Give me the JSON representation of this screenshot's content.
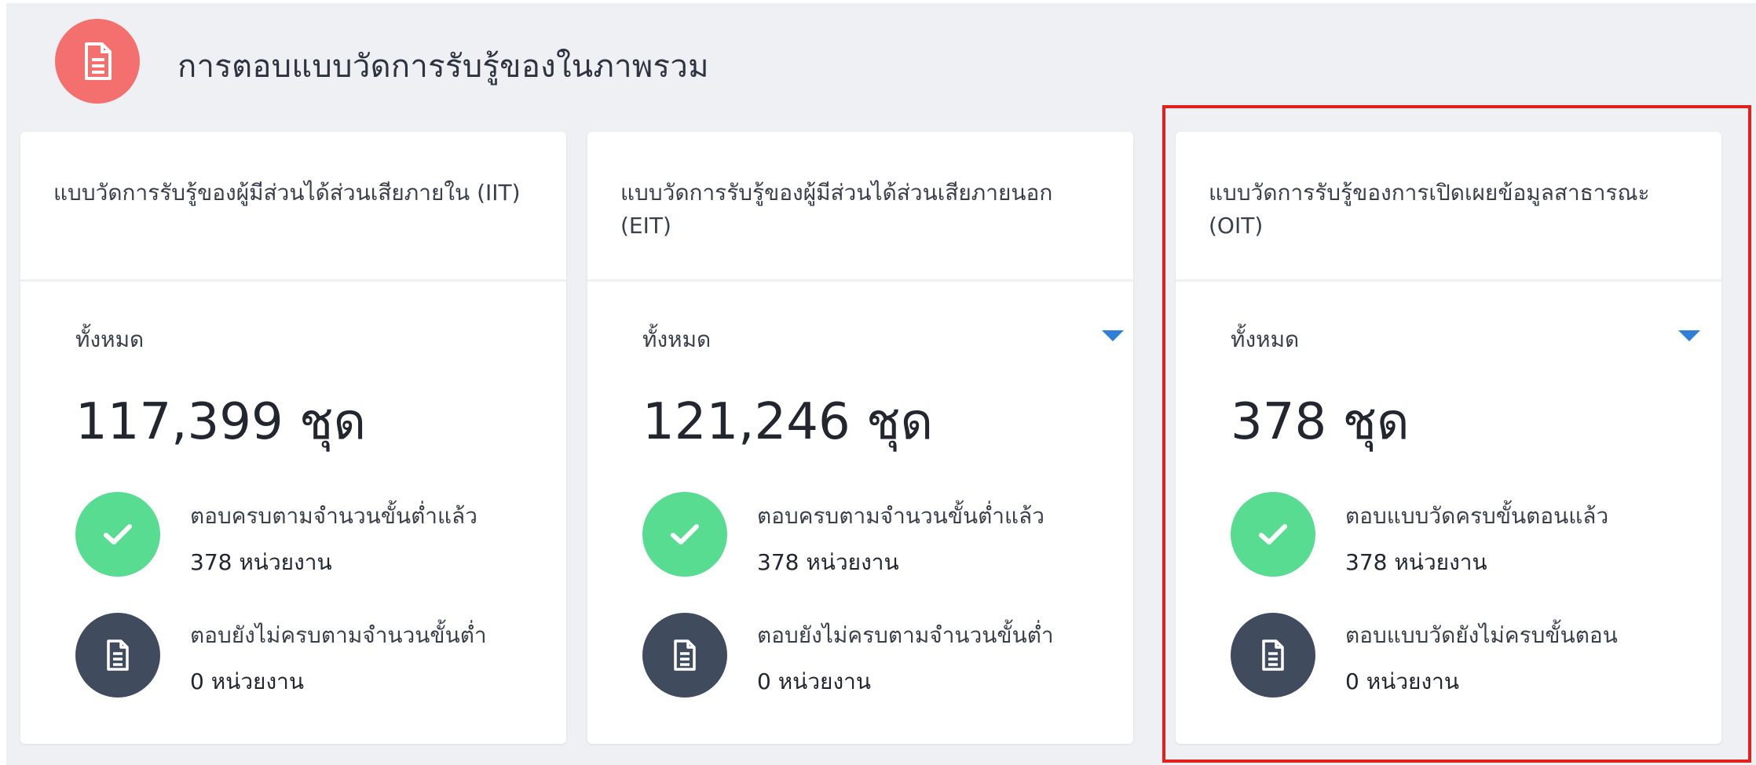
{
  "header": {
    "title": "การตอบแบบวัดการรับรู้ของในภาพรวม",
    "icon": "document-icon",
    "icon_color": "#f4706e"
  },
  "cards": [
    {
      "title": "แบบวัดการรับรู้ของผู้มีส่วนได้ส่วนเสียภายใน (IIT)",
      "total_label": "ทั้งหมด",
      "total_value": "117,399 ชุด",
      "has_dropdown": false,
      "stats": [
        {
          "icon": "check-icon",
          "label": "ตอบครบตามจำนวนขั้นต่ำแล้ว",
          "value": "378 หน่วยงาน"
        },
        {
          "icon": "document-icon",
          "label": "ตอบยังไม่ครบตามจำนวนขั้นต่ำ",
          "value": "0 หน่วยงาน"
        }
      ]
    },
    {
      "title": "แบบวัดการรับรู้ของผู้มีส่วนได้ส่วนเสียภายนอก (EIT)",
      "total_label": "ทั้งหมด",
      "total_value": "121,246 ชุด",
      "has_dropdown": true,
      "stats": [
        {
          "icon": "check-icon",
          "label": "ตอบครบตามจำนวนขั้นต่ำแล้ว",
          "value": "378 หน่วยงาน"
        },
        {
          "icon": "document-icon",
          "label": "ตอบยังไม่ครบตามจำนวนขั้นต่ำ",
          "value": "0 หน่วยงาน"
        }
      ]
    },
    {
      "title": "แบบวัดการรับรู้ของการเปิดเผยข้อมูลสาธารณะ (OIT)",
      "total_label": "ทั้งหมด",
      "total_value": "378 ชุด",
      "has_dropdown": true,
      "stats": [
        {
          "icon": "check-icon",
          "label": "ตอบแบบวัดครบขั้นตอนแล้ว",
          "value": "378 หน่วยงาน"
        },
        {
          "icon": "document-icon",
          "label": "ตอบแบบวัดยังไม่ครบขั้นตอน",
          "value": "0 หน่วยงาน"
        }
      ]
    }
  ],
  "colors": {
    "success": "#57dc91",
    "neutral_icon": "#414b5e",
    "dropdown_caret": "#2f7fd6",
    "highlight_border": "#e4201d"
  }
}
